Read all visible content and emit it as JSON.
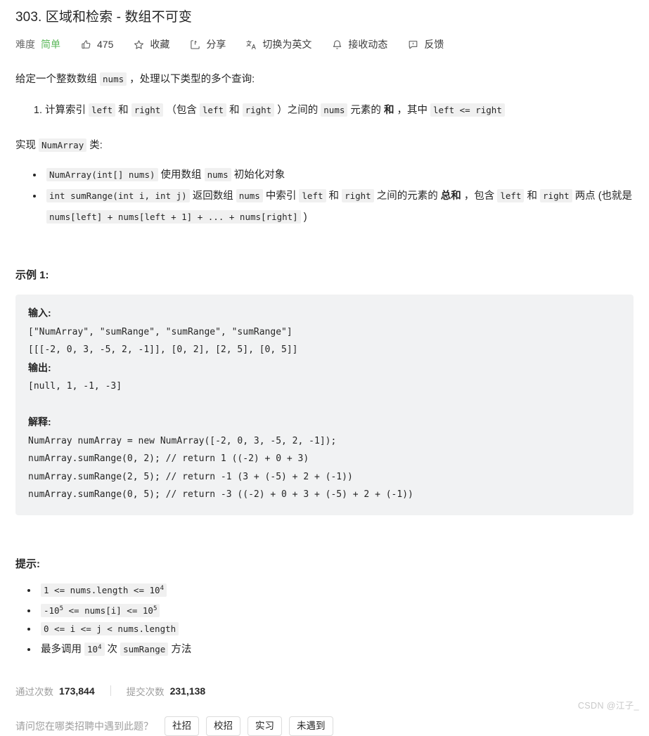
{
  "problem": {
    "title": "303. 区域和检索 - 数组不可变"
  },
  "toolbar": {
    "difficulty_label": "难度",
    "difficulty_value": "简单",
    "difficulty_color": "#5db85c",
    "like_count": "475",
    "favorite_label": "收藏",
    "share_label": "分享",
    "translate_label": "切换为英文",
    "subscribe_label": "接收动态",
    "feedback_label": "反馈",
    "icons": {
      "like": "thumbs-up-icon",
      "favorite": "star-icon",
      "share": "share-icon",
      "translate": "translate-icon",
      "subscribe": "bell-icon",
      "feedback": "feedback-icon"
    }
  },
  "description": {
    "intro_1": "给定一个整数数组",
    "intro_code": "nums",
    "intro_2": "，处理以下类型的多个查询:",
    "ordered_item": {
      "t1": "计算索引",
      "c1": "left",
      "t2": "和",
      "c2": "right",
      "t3": "（包含",
      "c3": "left",
      "t4": "和",
      "c4": "right",
      "t5": "）之间的",
      "c5": "nums",
      "t6": "元素的",
      "b1": "和",
      "t7": "，其中",
      "c6": "left <= right"
    },
    "implement_1": "实现",
    "implement_code": "NumArray",
    "implement_2": "类:",
    "bullet_1": {
      "c1": "NumArray(int[] nums)",
      "t1": "使用数组",
      "c2": "nums",
      "t2": "初始化对象"
    },
    "bullet_2": {
      "c1": "int sumRange(int i, int j)",
      "t1": "返回数组",
      "c2": "nums",
      "t2": "中索引",
      "c3": "left",
      "t3": "和",
      "c4": "right",
      "t4": "之间的元素的",
      "b1": "总和",
      "t5": "，包含",
      "c5": "left",
      "t6": "和",
      "c6": "right",
      "t7": "两点 (也就是",
      "c7": "nums[left] + nums[left + 1] + ... + nums[right]",
      "t8": ")"
    }
  },
  "example": {
    "heading": "示例 1:",
    "input_label": "输入:",
    "input_lines": [
      "[\"NumArray\", \"sumRange\", \"sumRange\", \"sumRange\"]",
      "[[[-2, 0, 3, -5, 2, -1]], [0, 2], [2, 5], [0, 5]]"
    ],
    "output_label": "输出:",
    "output_lines": [
      "[null, 1, -1, -3]"
    ],
    "explain_label": "解释:",
    "explain_lines": [
      "NumArray numArray = new NumArray([-2, 0, 3, -5, 2, -1]);",
      "numArray.sumRange(0, 2); // return 1 ((-2) + 0 + 3)",
      "numArray.sumRange(2, 5); // return -1 (3 + (-5) + 2 + (-1))",
      "numArray.sumRange(0, 5); // return -3 ((-2) + 0 + 3 + (-5) + 2 + (-1))"
    ]
  },
  "hints": {
    "heading": "提示:",
    "item_1": {
      "pre": "1 <= nums.length <= 10",
      "sup": "4"
    },
    "item_2": {
      "pre": "-10",
      "sup": "5",
      "mid": " <= nums[i] <= ",
      "pre2": "10",
      "sup2": "5"
    },
    "item_3": {
      "text": "0 <= i <= j < nums.length"
    },
    "item_4": {
      "t1": "最多调用",
      "c1": "10",
      "sup": "4",
      "t2": "次",
      "c2": "sumRange",
      "t3": "方法"
    }
  },
  "stats": {
    "accepted_label": "通过次数",
    "accepted_value": "173,844",
    "submitted_label": "提交次数",
    "submitted_value": "231,138"
  },
  "poll": {
    "question": "请问您在哪类招聘中遇到此题？",
    "options": [
      "社招",
      "校招",
      "实习",
      "未遇到"
    ]
  },
  "watermark": {
    "text": "CSDN @江子_"
  }
}
